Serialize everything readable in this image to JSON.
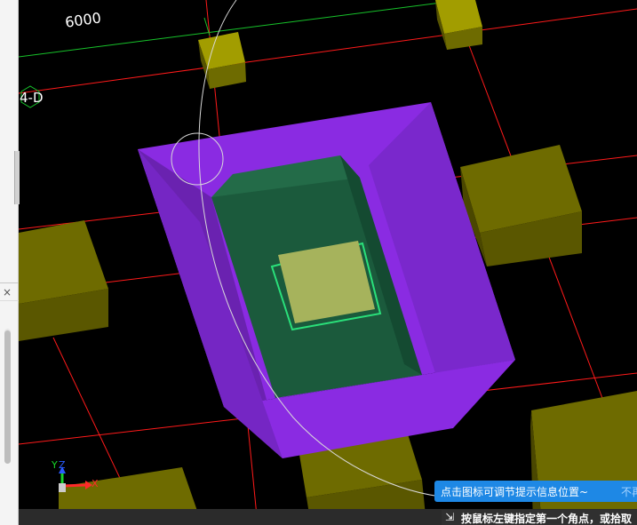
{
  "viewport": {
    "background": "#000000",
    "grid_label": "6000",
    "axis_tag": "4-D",
    "colors": {
      "grid_red": "#ff1a1a",
      "grid_green": "#17c22a",
      "column_olive": "#7b7800",
      "foundation_purple": "#8a2be2",
      "pit_green": "#1b5a3c",
      "pedestal": "#a6b35c",
      "outline_cyan": "#2ae07a"
    }
  },
  "ucs": {
    "x_label": "X",
    "y_label": "Y",
    "z_label": "Z"
  },
  "left_panel": {
    "close_label": "×"
  },
  "tooltip": {
    "text": "点击图标可调节提示信息位置~",
    "dismiss": "不再"
  },
  "command": {
    "icon": "cursor-corner-icon",
    "prompt": "按鼠标左键指定第一个角点，或拾取"
  }
}
